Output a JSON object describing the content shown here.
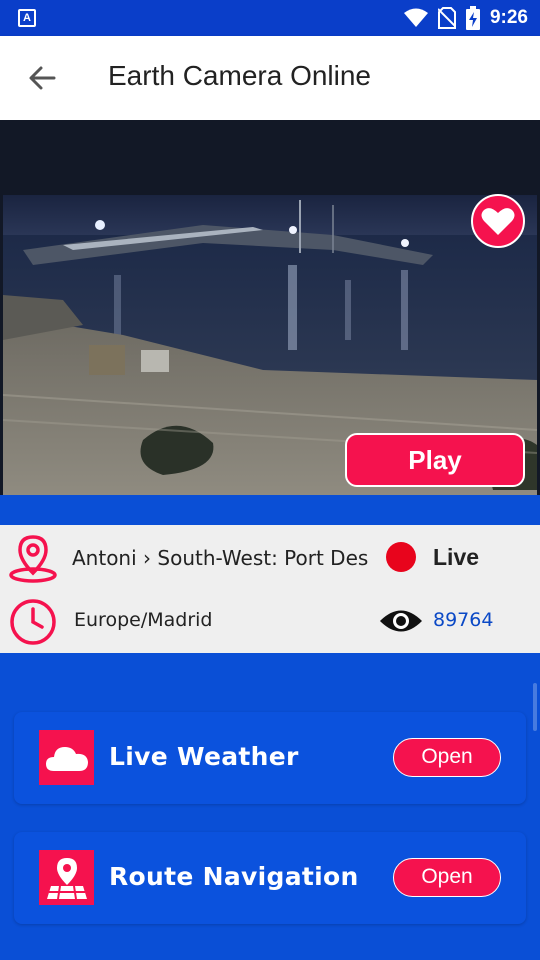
{
  "status_bar": {
    "badge": "A",
    "time": "9:26",
    "icons": [
      "wifi-icon",
      "no-sim-icon",
      "battery-charging-icon"
    ]
  },
  "app_bar": {
    "title": "Earth Camera Online",
    "back_icon": "arrow-left-icon"
  },
  "player": {
    "play_label": "Play",
    "favorite_icon": "heart-icon"
  },
  "info": {
    "location": "Antoni › South-West: Port Des Torrent",
    "status": "Live",
    "timezone": "Europe/Madrid",
    "views": "89764"
  },
  "features": [
    {
      "label": "Live Weather",
      "button": "Open",
      "icon": "cloud-icon"
    },
    {
      "label": "Route Navigation",
      "button": "Open",
      "icon": "map-pin-icon"
    }
  ],
  "colors": {
    "accent": "#f5124e",
    "background": "#0a4fd6",
    "status_bar": "#0a3ec9",
    "live_dot": "#e8041c",
    "views_text": "#0b49c6"
  }
}
